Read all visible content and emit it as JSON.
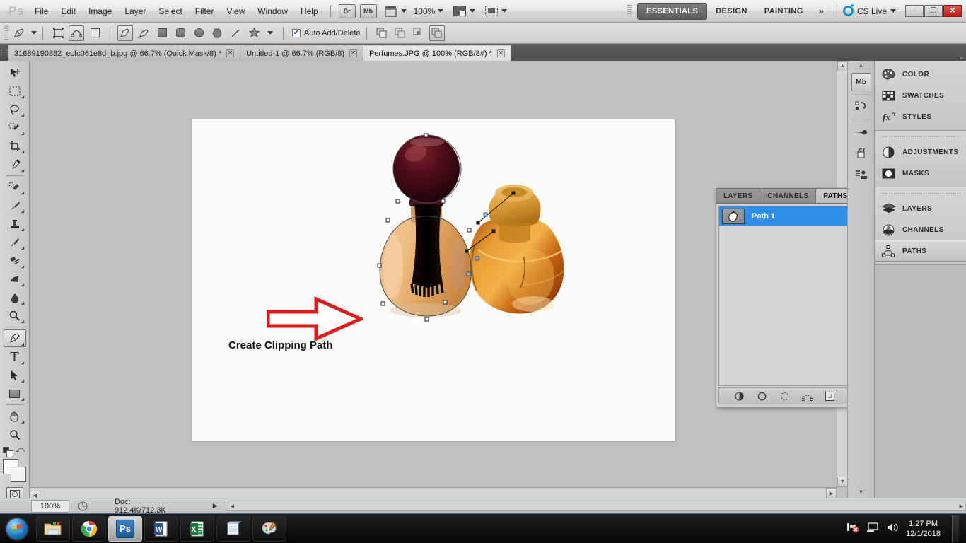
{
  "app": {
    "name": "Adobe Photoshop CS5",
    "logo": "Ps"
  },
  "menubar": {
    "items": [
      "File",
      "Edit",
      "Image",
      "Layer",
      "Select",
      "Filter",
      "View",
      "Window",
      "Help"
    ],
    "launch_bridge": "Br",
    "launch_minibridge": "Mb",
    "view_extras_icon": "view-extras-icon",
    "zoom_level": "100%",
    "arrange_icon": "arrange-documents-icon",
    "screen_mode_icon": "screen-mode-icon"
  },
  "workspaces": {
    "items": [
      "ESSENTIALS",
      "DESIGN",
      "PAINTING"
    ],
    "active": "ESSENTIALS",
    "more_icon": "chevron-double-right-icon",
    "cs_live": "CS Live",
    "window_buttons": {
      "minimize": "–",
      "restore": "❐",
      "close": "✕"
    }
  },
  "optionsbar": {
    "tool_preset_icon": "pen-tool-preset-icon",
    "mode_shape_layers": "shape-layers-icon",
    "mode_paths": "paths-mode-icon",
    "mode_fill_pixels": "fill-pixels-icon",
    "pen_tool": "pen-tool-icon",
    "freeform_pen_tool": "freeform-pen-tool-icon",
    "rectangle_tool": "rectangle-tool-icon",
    "rounded_rectangle_tool": "rounded-rectangle-tool-icon",
    "ellipse_tool": "ellipse-tool-icon",
    "polygon_tool": "polygon-tool-icon",
    "line_tool": "line-tool-icon",
    "custom_shape_tool": "custom-shape-tool-icon",
    "auto_add_delete_label": "Auto Add/Delete",
    "auto_add_delete_checked": true,
    "path_ops": [
      "add-to-path-area-icon",
      "subtract-from-path-area-icon",
      "intersect-path-areas-icon",
      "exclude-overlapping-path-areas-icon"
    ]
  },
  "tabs": [
    {
      "label": "31689190882_ecfc061e8d_b.jpg @ 66.7% (Quick Mask/8) *",
      "active": false,
      "close": "✕"
    },
    {
      "label": "Untitled-1 @ 66.7% (RGB/8)",
      "active": false,
      "close": "✕"
    },
    {
      "label": "Perfumes.JPG @ 100% (RGB/8#) *",
      "active": true,
      "close": "✕"
    }
  ],
  "toolbox": {
    "tools": [
      {
        "name": "move-tool",
        "glyph": "➤",
        "active": false,
        "flyout": false
      },
      {
        "name": "rectangular-marquee-tool",
        "glyph": "▭",
        "active": false,
        "flyout": true
      },
      {
        "name": "lasso-tool",
        "glyph": "◠",
        "active": false,
        "flyout": true
      },
      {
        "name": "quick-selection-tool",
        "glyph": "✦",
        "active": false,
        "flyout": true
      },
      {
        "name": "crop-tool",
        "glyph": "⌗",
        "active": false,
        "flyout": true
      },
      {
        "name": "eyedropper-tool",
        "glyph": "✎",
        "active": false,
        "flyout": true
      },
      {
        "name": "spot-healing-brush-tool",
        "glyph": "✜",
        "active": false,
        "flyout": true
      },
      {
        "name": "brush-tool",
        "glyph": "🖌",
        "active": false,
        "flyout": true
      },
      {
        "name": "clone-stamp-tool",
        "glyph": "⬓",
        "active": false,
        "flyout": true
      },
      {
        "name": "history-brush-tool",
        "glyph": "↯",
        "active": false,
        "flyout": true
      },
      {
        "name": "eraser-tool",
        "glyph": "✂",
        "active": false,
        "flyout": true
      },
      {
        "name": "gradient-tool",
        "glyph": "◨",
        "active": false,
        "flyout": true
      },
      {
        "name": "blur-tool",
        "glyph": "💧",
        "active": false,
        "flyout": true
      },
      {
        "name": "dodge-tool",
        "glyph": "◍",
        "active": false,
        "flyout": true
      },
      {
        "name": "pen-tool",
        "glyph": "✒",
        "active": true,
        "flyout": true
      },
      {
        "name": "horizontal-type-tool",
        "glyph": "T",
        "active": false,
        "flyout": true
      },
      {
        "name": "path-selection-tool",
        "glyph": "➤",
        "active": false,
        "flyout": true
      },
      {
        "name": "rectangle-shape-tool",
        "glyph": "▢",
        "active": false,
        "flyout": true
      },
      {
        "name": "hand-tool",
        "glyph": "✋",
        "active": false,
        "flyout": true
      },
      {
        "name": "zoom-tool",
        "glyph": "🔍",
        "active": false,
        "flyout": false
      }
    ],
    "default_colors_icon": "default-foreground-background-colors-icon",
    "swap_colors_icon": "swap-foreground-background-colors-icon",
    "foreground_color": "#ffffff",
    "background_color": "#f2f2f2",
    "quick_mask_icon": "edit-in-quick-mask-mode-icon"
  },
  "canvas": {
    "background_color": "#c0c0c0",
    "document_background": "#fbfbfa",
    "annotation_text": "Create Clipping Path",
    "arrow_color": "#e01b1b",
    "arrow_name": "red-arrow-annotation",
    "artwork_name": "perfume-bottles-image",
    "path_overlay": "pen-path-anchor-points"
  },
  "paths_panel": {
    "tabs": [
      {
        "label": "LAYERS",
        "active": false
      },
      {
        "label": "CHANNELS",
        "active": false
      },
      {
        "label": "PATHS",
        "active": true
      }
    ],
    "collapse_icon": "collapse-to-icons-icon",
    "menu_icon": "panel-menu-icon",
    "paths": [
      {
        "name": "Path 1",
        "selected": true,
        "thumbnail": "path-thumbnail"
      }
    ],
    "bottom_buttons": [
      {
        "name": "fill-path-with-foreground-color-button",
        "glyph": "◕"
      },
      {
        "name": "stroke-path-with-brush-button",
        "glyph": "○"
      },
      {
        "name": "load-path-as-selection-button",
        "glyph": "◌"
      },
      {
        "name": "make-work-path-from-selection-button",
        "glyph": "⬡"
      },
      {
        "name": "create-new-path-button",
        "glyph": "▣"
      },
      {
        "name": "delete-current-path-button",
        "glyph": "🗑"
      }
    ]
  },
  "icon_column": [
    {
      "name": "mini-bridge-icon",
      "glyph": "Mb",
      "boxed": true
    },
    {
      "name": "history-icon",
      "glyph": "↺",
      "boxed": false
    },
    {
      "name": "brush-presets-icon",
      "glyph": "🖌",
      "boxed": false
    },
    {
      "name": "brush-panel-icon",
      "glyph": "❦",
      "boxed": false
    },
    {
      "name": "tool-presets-icon",
      "glyph": "⛭",
      "boxed": false
    }
  ],
  "dock": {
    "groups": [
      {
        "items": [
          {
            "label": "COLOR",
            "icon": "color-palette-icon",
            "glyph": "🎨",
            "active": false
          },
          {
            "label": "SWATCHES",
            "icon": "swatches-grid-icon",
            "glyph": "▦",
            "active": false
          },
          {
            "label": "STYLES",
            "icon": "styles-fx-icon",
            "glyph": "fx",
            "active": false
          }
        ]
      },
      {
        "items": [
          {
            "label": "ADJUSTMENTS",
            "icon": "adjustments-halfcircle-icon",
            "glyph": "◐",
            "active": false
          },
          {
            "label": "MASKS",
            "icon": "masks-icon",
            "glyph": "◙",
            "active": false
          }
        ]
      },
      {
        "items": [
          {
            "label": "LAYERS",
            "icon": "layers-stack-icon",
            "glyph": "◈",
            "active": false
          },
          {
            "label": "CHANNELS",
            "icon": "channels-icon",
            "glyph": "◑",
            "active": false
          },
          {
            "label": "PATHS",
            "icon": "paths-icon",
            "glyph": "⬟",
            "active": true
          }
        ]
      }
    ]
  },
  "statusbar": {
    "zoom": "100%",
    "preview_icon": "preview-thumbnail-icon",
    "doc_info": "Doc: 912.4K/712.3K",
    "expand_icon": "▶"
  },
  "taskbar": {
    "start_icon": "windows-start-orb",
    "items": [
      {
        "name": "windows-explorer-taskbar-icon",
        "glyph": "📁",
        "active": false
      },
      {
        "name": "google-chrome-taskbar-icon",
        "glyph": "◎",
        "active": false
      },
      {
        "name": "photoshop-taskbar-icon",
        "glyph": "Ps",
        "active": true
      },
      {
        "name": "microsoft-word-taskbar-icon",
        "glyph": "W",
        "active": false
      },
      {
        "name": "microsoft-excel-taskbar-icon",
        "glyph": "X",
        "active": false
      },
      {
        "name": "notepad-taskbar-icon",
        "glyph": "📓",
        "active": false
      },
      {
        "name": "paint-taskbar-icon",
        "glyph": "🎨",
        "active": false
      }
    ],
    "tray": [
      {
        "name": "network-error-tray-icon",
        "glyph": "🖧"
      },
      {
        "name": "display-tray-icon",
        "glyph": "🖵"
      },
      {
        "name": "volume-tray-icon",
        "glyph": "🔊"
      }
    ],
    "time": "1:27 PM",
    "date": "12/1/2018"
  }
}
